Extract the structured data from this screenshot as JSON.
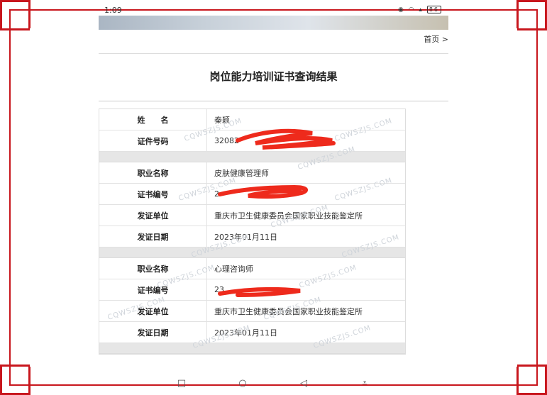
{
  "status_bar": {
    "time": "1:09",
    "battery": "86",
    "icons": "◉ ◠ ▴"
  },
  "header": {
    "home_link": "首页 >"
  },
  "page": {
    "title": "岗位能力培训证书查询结果"
  },
  "person": [
    {
      "label": "姓　　名",
      "value": "秦颖"
    },
    {
      "label": "证件号码",
      "value": "32082"
    }
  ],
  "certificates": [
    {
      "rows": [
        {
          "label": "职业名称",
          "value": "皮肤健康管理师"
        },
        {
          "label": "证书编号",
          "value": "2"
        },
        {
          "label": "发证单位",
          "value": "重庆市卫生健康委员会国家职业技能鉴定所"
        },
        {
          "label": "发证日期",
          "value": "2023年01月11日"
        }
      ]
    },
    {
      "rows": [
        {
          "label": "职业名称",
          "value": "心理咨询师"
        },
        {
          "label": "证书编号",
          "value": "23"
        },
        {
          "label": "发证单位",
          "value": "重庆市卫生健康委员会国家职业技能鉴定所"
        },
        {
          "label": "发证日期",
          "value": "2023年01月11日"
        }
      ]
    }
  ],
  "watermark": "CQWSZJS.COM",
  "nav_bar": {
    "square": "□",
    "circle": "○",
    "back": "◁",
    "menu": "⩡"
  },
  "colors": {
    "frame": "#c8161d",
    "redaction": "#ee2a1c"
  }
}
